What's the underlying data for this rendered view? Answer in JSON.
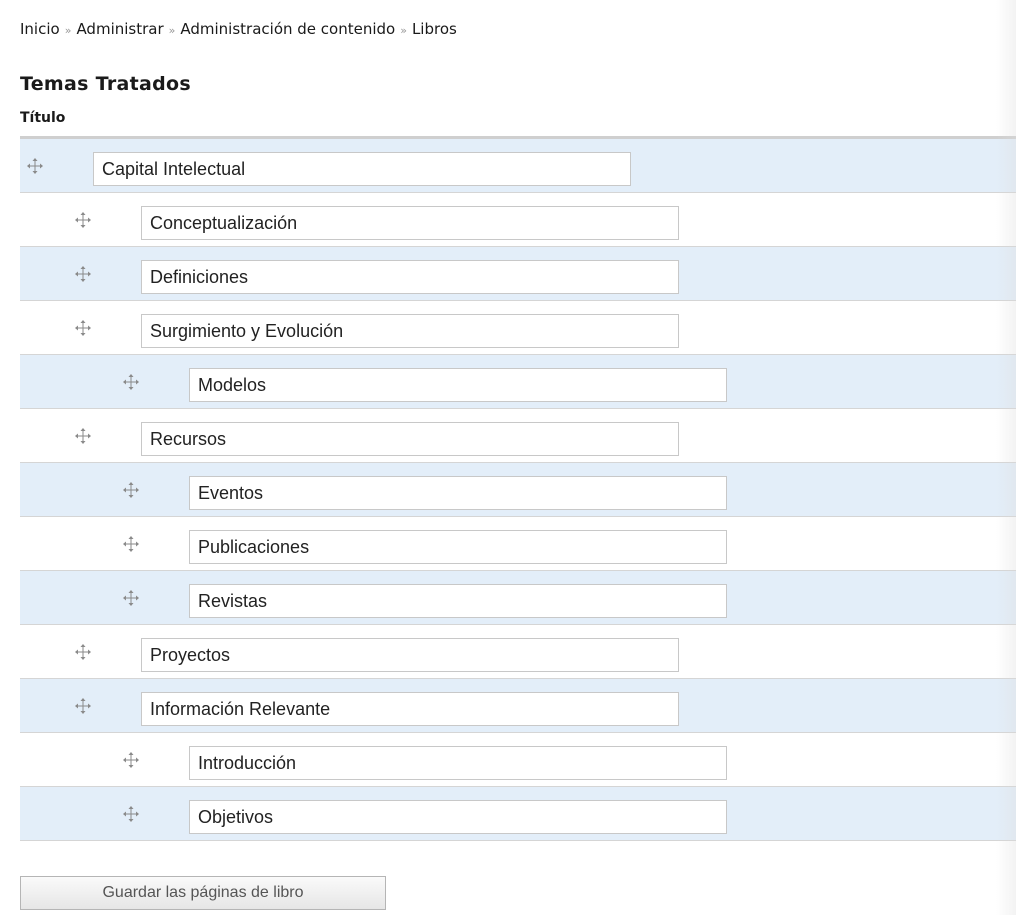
{
  "breadcrumb": {
    "items": [
      "Inicio",
      "Administrar",
      "Administración de contenido",
      "Libros"
    ],
    "separator": "»"
  },
  "page": {
    "title": "Temas Tratados",
    "column_header": "Título"
  },
  "rows": [
    {
      "title": "Capital Intelectual",
      "depth": 0
    },
    {
      "title": "Conceptualización",
      "depth": 1
    },
    {
      "title": "Definiciones",
      "depth": 1
    },
    {
      "title": "Surgimiento y Evolución",
      "depth": 1
    },
    {
      "title": "Modelos",
      "depth": 2
    },
    {
      "title": "Recursos",
      "depth": 1
    },
    {
      "title": "Eventos",
      "depth": 2
    },
    {
      "title": "Publicaciones",
      "depth": 2
    },
    {
      "title": "Revistas",
      "depth": 2
    },
    {
      "title": "Proyectos",
      "depth": 1
    },
    {
      "title": "Información Relevante",
      "depth": 1
    },
    {
      "title": "Introducción",
      "depth": 2
    },
    {
      "title": "Objetivos",
      "depth": 2
    }
  ],
  "actions": {
    "save_label": "Guardar las páginas de libro"
  },
  "icons": {
    "drag_handle": "move-arrows-icon"
  },
  "colors": {
    "row_alt_background": "#e3eef9",
    "row_background": "#ffffff"
  }
}
